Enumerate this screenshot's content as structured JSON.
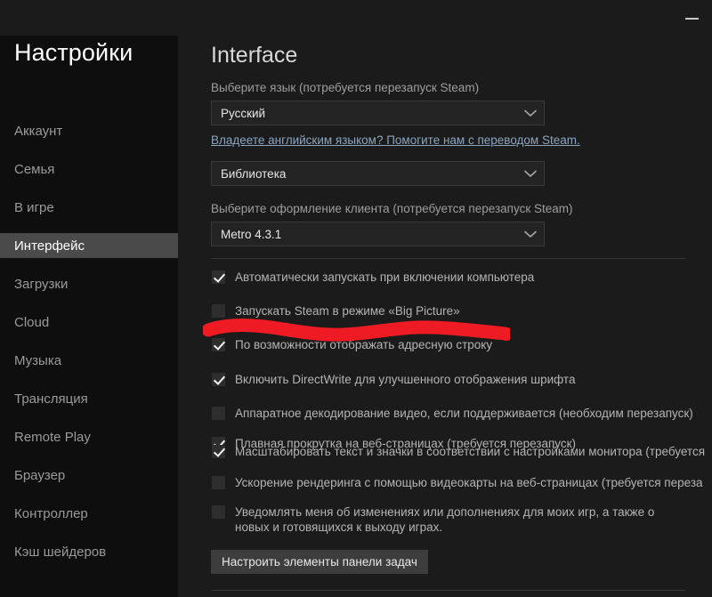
{
  "window": {
    "minimize_label": "—"
  },
  "sidebar": {
    "title": "Настройки",
    "items": [
      {
        "label": "Аккаунт",
        "active": false
      },
      {
        "label": "Семья",
        "active": false
      },
      {
        "label": "В игре",
        "active": false
      },
      {
        "label": "Интерфейс",
        "active": true
      },
      {
        "label": "Загрузки",
        "active": false
      },
      {
        "label": "Cloud",
        "active": false
      },
      {
        "label": "Музыка",
        "active": false
      },
      {
        "label": "Трансляция",
        "active": false
      },
      {
        "label": "Remote Play",
        "active": false
      },
      {
        "label": "Браузер",
        "active": false
      },
      {
        "label": "Контроллер",
        "active": false
      },
      {
        "label": "Кэш шейдеров",
        "active": false
      }
    ]
  },
  "main": {
    "page_title": "Interface",
    "language_label": "Выберите язык (потребуется перезапуск Steam)",
    "language_value": "Русский",
    "translation_link": "Владеете английским языком? Помогите нам с переводом Steam.",
    "startup_page_value": "Библиотека",
    "skin_label": "Выберите оформление клиента (потребуется перезапуск Steam)",
    "skin_value": "Metro 4.3.1",
    "checkboxes": [
      {
        "label": "Автоматически запускать при включении компьютера",
        "checked": true
      },
      {
        "label": "Запускать Steam в режиме «Big Picture»",
        "checked": false
      },
      {
        "label": "По возможности отображать адресную строку",
        "checked": true
      },
      {
        "label": "Включить DirectWrite для улучшенного отображения шрифта",
        "checked": true
      },
      {
        "label": "Аппаратное декодирование видео, если поддерживается (необходим перезапуск)",
        "checked": false
      },
      {
        "label": "Плавная прокрутка на веб-страницах (требуется перезапуск)",
        "checked": true
      },
      {
        "label": "Масштабировать текст и значки в соответствии с настройками монитора (требуется",
        "checked": true
      },
      {
        "label": "Ускорение рендеринга с помощью видеокарты на веб-страницах (требуется переза",
        "checked": false
      },
      {
        "label": "Уведомлять меня об изменениях или дополнениях для моих игр, а также о новых и готовящихся к выходу играх.",
        "checked": false
      }
    ],
    "taskbar_button": "Настроить элементы панели задач"
  },
  "annotation": {
    "stroke_color": "#ee1b24"
  },
  "colors": {
    "background": "#1b1b1b",
    "sidebar_background": "#0e0e0e",
    "active_item": "#4a4a4a",
    "link": "#8ba4bf",
    "text_primary": "#e6e6e6",
    "text_secondary": "#9d9d9d"
  }
}
